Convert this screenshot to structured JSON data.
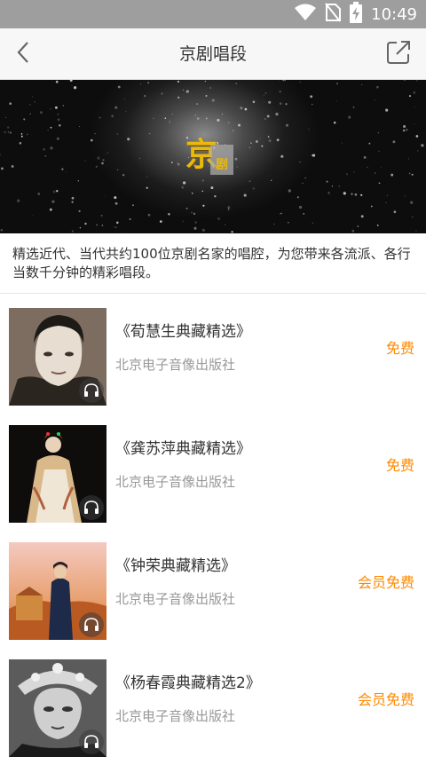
{
  "status_bar": {
    "time": "10:49",
    "icons": [
      "wifi-icon",
      "no-sim-icon",
      "battery-charging-icon"
    ]
  },
  "header": {
    "title": "京剧唱段",
    "back_icon": "chevron-left-icon",
    "share_icon": "share-external-icon"
  },
  "banner": {
    "logo_main": "京",
    "logo_sub": "剧"
  },
  "description": "精选近代、当代共约100位京剧名家的唱腔，为您带来各流派、各行当数千分钟的精彩唱段。",
  "colors": {
    "accent": "#ff8a00",
    "status_bar": "#9e9e9e",
    "app_bar": "#f7f7f7",
    "logo_gold": "#e9b90e"
  },
  "items": [
    {
      "title": "《荀慧生典藏精选》",
      "publisher": "北京电子音像出版社",
      "price": "免费"
    },
    {
      "title": "《龚苏萍典藏精选》",
      "publisher": "北京电子音像出版社",
      "price": "免费"
    },
    {
      "title": "《钟荣典藏精选》",
      "publisher": "北京电子音像出版社",
      "price": "会员免费"
    },
    {
      "title": "《杨春霞典藏精选2》",
      "publisher": "北京电子音像出版社",
      "price": "会员免费"
    }
  ]
}
